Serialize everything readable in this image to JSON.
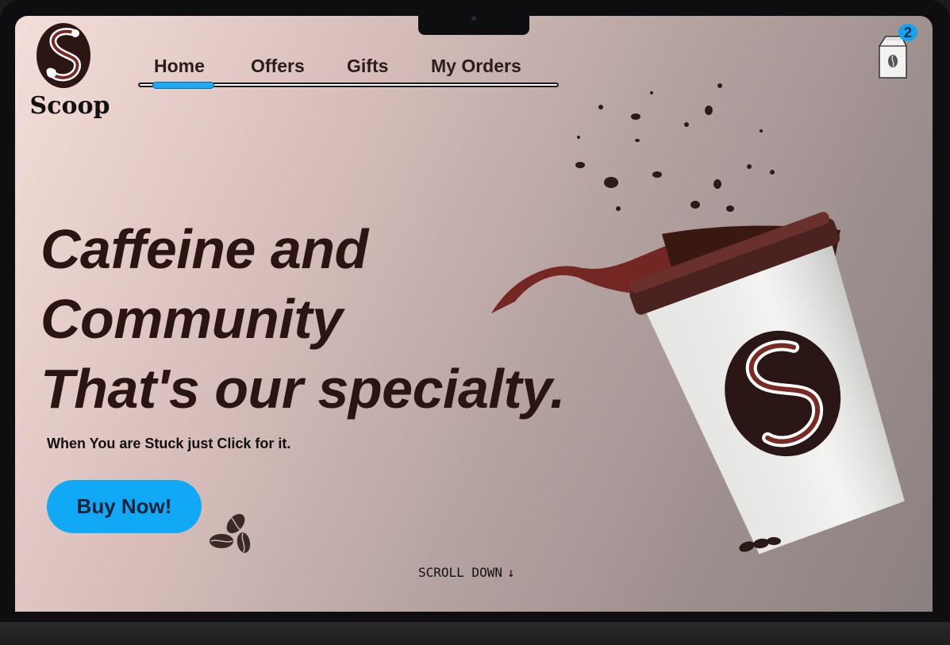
{
  "brand": {
    "name": "Scoop",
    "logo_icon": "swirl-s-logo-icon"
  },
  "nav": {
    "items": [
      {
        "label": "Home",
        "active": true
      },
      {
        "label": "Offers",
        "active": false
      },
      {
        "label": "Gifts",
        "active": false
      },
      {
        "label": "My Orders",
        "active": false
      }
    ]
  },
  "cart": {
    "icon": "coffee-bag-icon",
    "count": "2",
    "badge_color": "#14a4ef"
  },
  "hero": {
    "headline_line1": "Caffeine and",
    "headline_line2": "Community",
    "headline_line3": "That's our specialty.",
    "subtext": "When You are Stuck just Click for it.",
    "cta_label": "Buy Now!",
    "cta_color": "#11a9f6",
    "beans_icon": "coffee-beans-icon",
    "image": "coffee-cup-splash-illustration"
  },
  "scroll": {
    "label": "SCROLL DOWN",
    "arrow": "↓"
  },
  "colors": {
    "headline": "#2a1514",
    "accent": "#1ea9f0",
    "brand_brown": "#5a1e1a"
  }
}
